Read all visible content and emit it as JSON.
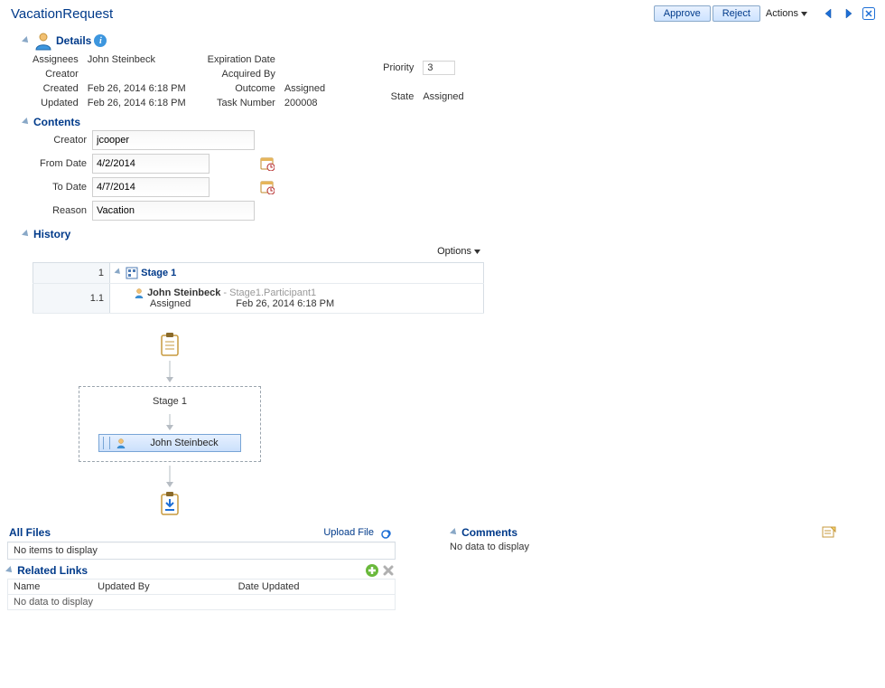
{
  "header": {
    "title": "VacationRequest",
    "approve": "Approve",
    "reject": "Reject",
    "actions": "Actions"
  },
  "details": {
    "section": "Details",
    "assignees_l": "Assignees",
    "assignees": "John Steinbeck",
    "creator_l": "Creator",
    "creator": "",
    "created_l": "Created",
    "created": "Feb 26, 2014 6:18 PM",
    "updated_l": "Updated",
    "updated": "Feb 26, 2014 6:18 PM",
    "expiration_l": "Expiration Date",
    "expiration": "",
    "acquired_l": "Acquired By",
    "acquired": "",
    "outcome_l": "Outcome",
    "outcome": "Assigned",
    "tasknum_l": "Task Number",
    "tasknum": "200008",
    "priority_l": "Priority",
    "priority": "3",
    "state_l": "State",
    "state": "Assigned"
  },
  "contents": {
    "section": "Contents",
    "creator_l": "Creator",
    "creator": "jcooper",
    "from_l": "From Date",
    "from": "4/2/2014",
    "to_l": "To Date",
    "to": "4/7/2014",
    "reason_l": "Reason",
    "reason": "Vacation"
  },
  "history": {
    "section": "History",
    "options": "Options",
    "row1_num": "1",
    "row1_stage": "Stage 1",
    "row2_num": "1.1",
    "row2_person": "John Steinbeck",
    "row2_participant": " - Stage1.Participant1",
    "row2_status": "Assigned",
    "row2_date": "Feb 26, 2014 6:18 PM",
    "flow_stage": "Stage 1",
    "flow_person": "John Steinbeck"
  },
  "files": {
    "title": "All Files",
    "upload": "Upload File",
    "empty": "No items to display"
  },
  "related": {
    "title": "Related Links",
    "col_name": "Name",
    "col_updatedby": "Updated By",
    "col_dateupdated": "Date Updated",
    "empty": "No data to display"
  },
  "comments": {
    "title": "Comments",
    "empty": "No data to display"
  }
}
